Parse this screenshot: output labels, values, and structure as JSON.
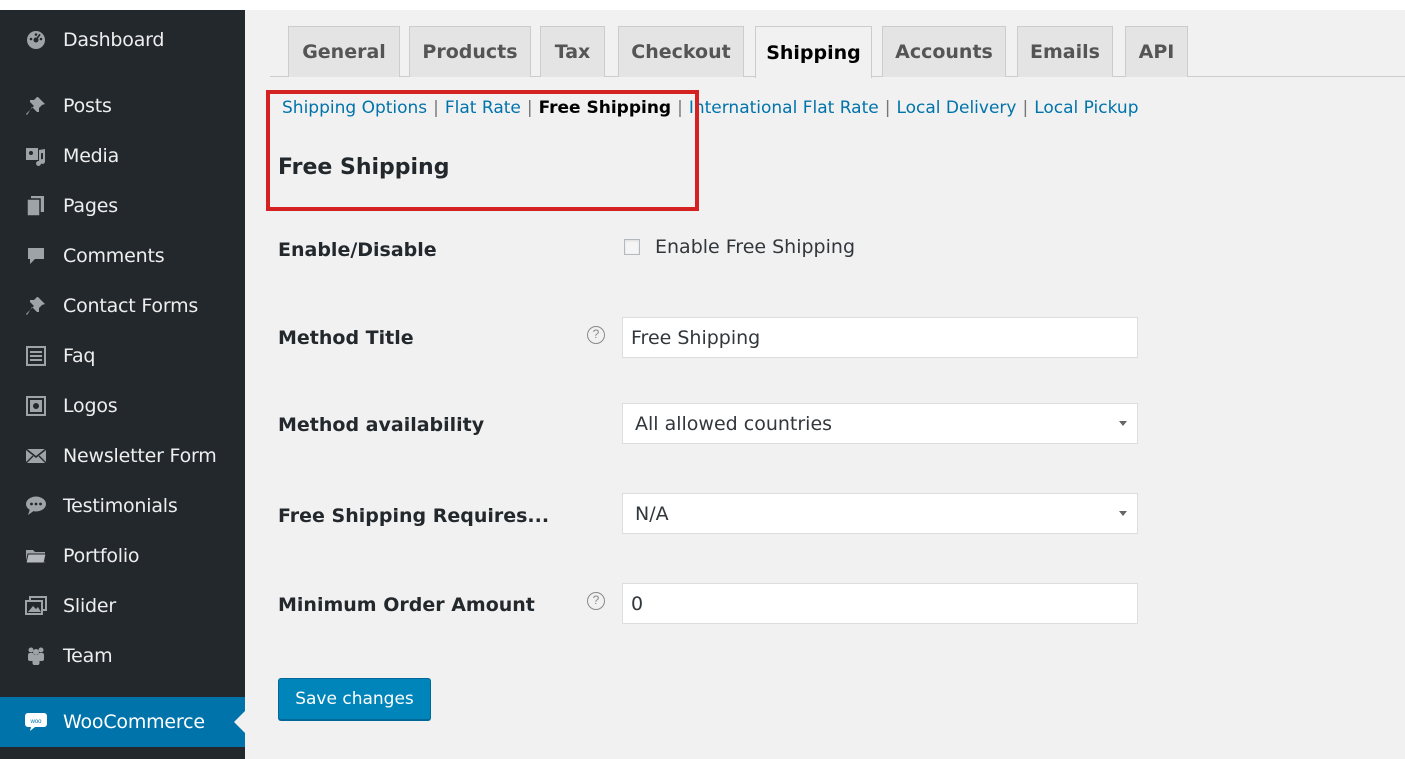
{
  "sidebar": {
    "items": [
      {
        "label": "Dashboard",
        "icon": "dashboard-icon"
      },
      {
        "label": "Posts",
        "icon": "pin-icon"
      },
      {
        "label": "Media",
        "icon": "media-icon"
      },
      {
        "label": "Pages",
        "icon": "pages-icon"
      },
      {
        "label": "Comments",
        "icon": "comments-icon"
      },
      {
        "label": "Contact Forms",
        "icon": "pin-icon"
      },
      {
        "label": "Faq",
        "icon": "list-icon"
      },
      {
        "label": "Logos",
        "icon": "image-icon"
      },
      {
        "label": "Newsletter Form",
        "icon": "email-icon"
      },
      {
        "label": "Testimonials",
        "icon": "speech-bubble-icon"
      },
      {
        "label": "Portfolio",
        "icon": "folder-icon"
      },
      {
        "label": "Slider",
        "icon": "gallery-icon"
      },
      {
        "label": "Team",
        "icon": "groups-icon"
      },
      {
        "label": "WooCommerce",
        "icon": "woo-icon",
        "active": true
      }
    ]
  },
  "tabs": [
    "General",
    "Products",
    "Tax",
    "Checkout",
    "Shipping",
    "Accounts",
    "Emails",
    "API"
  ],
  "active_tab": "Shipping",
  "subnav": {
    "links": [
      "Shipping Options",
      "Flat Rate",
      "Free Shipping",
      "International Flat Rate",
      "Local Delivery",
      "Local Pickup"
    ],
    "current": "Free Shipping"
  },
  "section_title": "Free Shipping",
  "form": {
    "enable": {
      "label": "Enable/Disable",
      "checkbox_label": "Enable Free Shipping",
      "checked": false
    },
    "method_title": {
      "label": "Method Title",
      "value": "Free Shipping",
      "help": "?"
    },
    "availability": {
      "label": "Method availability",
      "value": "All allowed countries"
    },
    "requires": {
      "label": "Free Shipping Requires...",
      "value": "N/A"
    },
    "min_amount": {
      "label": "Minimum Order Amount",
      "value": "0",
      "help": "?"
    }
  },
  "save_button": "Save changes",
  "colors": {
    "sidebar_bg": "#23282d",
    "accent": "#0073aa",
    "highlight": "#d42121",
    "button": "#0085ba"
  }
}
